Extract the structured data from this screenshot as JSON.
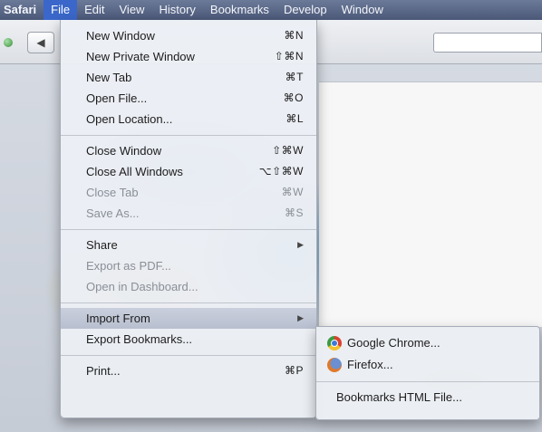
{
  "menubar": {
    "items": [
      {
        "label": "Safari"
      },
      {
        "label": "File"
      },
      {
        "label": "Edit"
      },
      {
        "label": "View"
      },
      {
        "label": "History"
      },
      {
        "label": "Bookmarks"
      },
      {
        "label": "Develop"
      },
      {
        "label": "Window"
      }
    ]
  },
  "file_menu": {
    "group1": [
      {
        "label": "New Window",
        "shortcut": "⌘N"
      },
      {
        "label": "New Private Window",
        "shortcut": "⇧⌘N"
      },
      {
        "label": "New Tab",
        "shortcut": "⌘T"
      },
      {
        "label": "Open File...",
        "shortcut": "⌘O"
      },
      {
        "label": "Open Location...",
        "shortcut": "⌘L"
      }
    ],
    "group2": [
      {
        "label": "Close Window",
        "shortcut": "⇧⌘W"
      },
      {
        "label": "Close All Windows",
        "shortcut": "⌥⇧⌘W"
      },
      {
        "label": "Close Tab",
        "shortcut": "⌘W"
      },
      {
        "label": "Save As...",
        "shortcut": "⌘S"
      }
    ],
    "group3": [
      {
        "label": "Share"
      },
      {
        "label": "Export as PDF..."
      },
      {
        "label": "Open in Dashboard..."
      }
    ],
    "group4": [
      {
        "label": "Import From"
      },
      {
        "label": "Export Bookmarks..."
      }
    ],
    "group5": [
      {
        "label": "Print...",
        "shortcut": "⌘P"
      }
    ]
  },
  "import_submenu": {
    "items": [
      {
        "label": "Google Chrome...",
        "icon": "chrome-icon"
      },
      {
        "label": "Firefox...",
        "icon": "firefox-icon"
      }
    ],
    "bookmarks_html": "Bookmarks HTML File..."
  }
}
